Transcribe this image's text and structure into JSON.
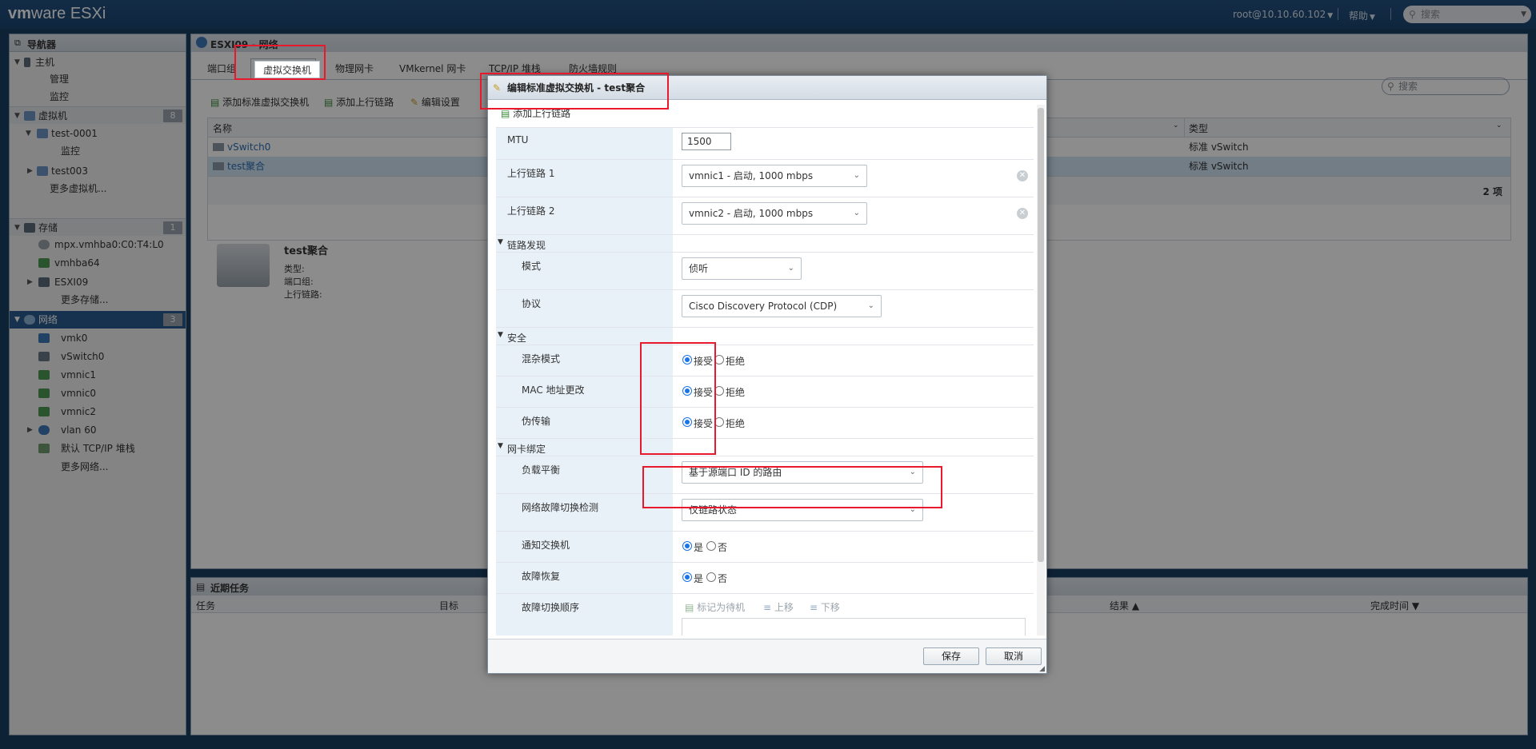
{
  "topbar": {
    "brand_vm": "vm",
    "brand_ware": "ware",
    "brand_product": " ESXi",
    "user": "root@10.10.60.102",
    "help": "帮助",
    "search_placeholder": "搜索"
  },
  "navigator": {
    "title": "导航器",
    "host": {
      "label": "主机",
      "items": [
        "管理",
        "监控"
      ]
    },
    "vms": {
      "label": "虚拟机",
      "count": "8",
      "items": [
        "test-0001",
        "监控",
        "test003",
        "更多虚拟机..."
      ]
    },
    "storage": {
      "label": "存储",
      "count": "1",
      "items": [
        "mpx.vmhba0:C0:T4:L0",
        "vmhba64",
        "ESXI09",
        "更多存储..."
      ]
    },
    "network": {
      "label": "网络",
      "count": "3",
      "items": [
        "vmk0",
        "vSwitch0",
        "vmnic1",
        "vmnic0",
        "vmnic2",
        "vlan 60",
        "默认 TCP/IP 堆栈",
        "更多网络..."
      ]
    }
  },
  "main": {
    "breadcrumb": "ESXI09 - 网络",
    "tabs": [
      "端口组",
      "虚拟交换机",
      "物理网卡",
      "VMkernel 网卡",
      "TCP/IP 堆栈",
      "防火墙规则"
    ],
    "active_tab": "虚拟交换机",
    "toolbar": [
      "添加标准虚拟交换机",
      "添加上行链路",
      "编辑设置"
    ],
    "search_placeholder": "搜索",
    "columns": [
      "名称",
      "类型"
    ],
    "rows": [
      {
        "name": "vSwitch0",
        "type": "标准 vSwitch"
      },
      {
        "name": "test聚合",
        "type": "标准 vSwitch"
      }
    ],
    "item_count": "2 项",
    "detail": {
      "title": "test聚合",
      "labels": [
        "类型:",
        "端口组:",
        "上行链路:"
      ]
    }
  },
  "tasks": {
    "title": "近期任务",
    "columns": [
      "任务",
      "目标",
      "结果 ▲",
      "完成时间 ▼"
    ]
  },
  "dialog": {
    "title": "编辑标准虚拟交换机 - test聚合",
    "add_uplink": "添加上行链路",
    "mtu_label": "MTU",
    "mtu_value": "1500",
    "uplink1_label": "上行链路 1",
    "uplink1_value": "vmnic1 - 启动, 1000 mbps",
    "uplink2_label": "上行链路 2",
    "uplink2_value": "vmnic2 - 启动, 1000 mbps",
    "link_discovery": "链路发现",
    "mode_label": "模式",
    "mode_value": "侦听",
    "protocol_label": "协议",
    "protocol_value": "Cisco Discovery Protocol (CDP)",
    "security": "安全",
    "promiscuous_label": "混杂模式",
    "mac_change_label": "MAC 地址更改",
    "forged_label": "伪传输",
    "accept": "接受",
    "reject": "拒绝",
    "nic_teaming": "网卡绑定",
    "load_balance_label": "负载平衡",
    "load_balance_value": "基于源端口 ID 的路由",
    "failover_detect_label": "网络故障切换检测",
    "failover_detect_value": "仅链路状态",
    "notify_label": "通知交换机",
    "failback_label": "故障恢复",
    "yes": "是",
    "no": "否",
    "failover_order_label": "故障切换顺序",
    "order_actions": [
      "标记为待机",
      "上移",
      "下移"
    ],
    "save": "保存",
    "cancel": "取消"
  },
  "colors": {
    "accent": "#1a73e8",
    "highlight": "#e8192c",
    "topbar": "#1f4a77"
  }
}
